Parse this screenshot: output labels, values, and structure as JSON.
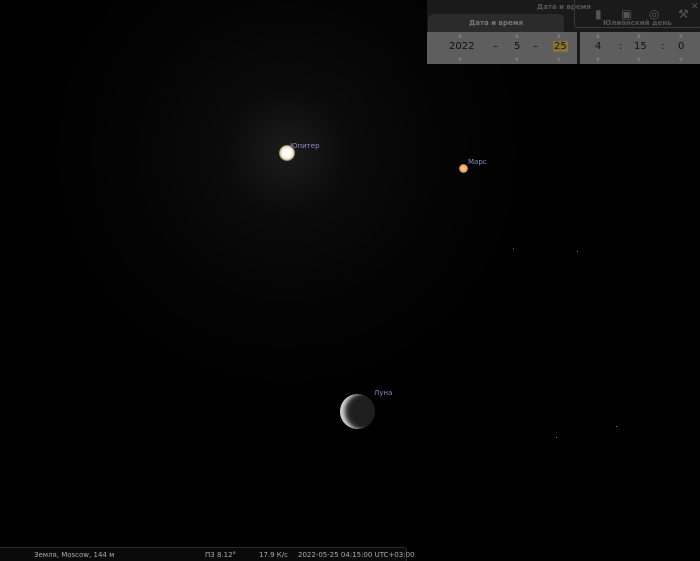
{
  "sky": {
    "jupiter_label": "Юпитер",
    "mars_label": "Марс",
    "moon_label": "Луна"
  },
  "datetime_panel": {
    "title": "Дата и время",
    "tab_label": "Дата и время",
    "julian_day_label": "Юлианский день",
    "year": "2022",
    "month": "5",
    "day": "25",
    "hour": "4",
    "minute": "15",
    "second": "0",
    "date_sep": "–",
    "time_sep": ":",
    "close": "✕"
  },
  "status_bar": {
    "location": "Земля, Moscow, 144 м",
    "fov": "П3 8.12°",
    "fps": "17.9 К/с",
    "datetime": "2022-05-25 04:15:00 UTC+03:00"
  },
  "colors": {
    "label": "#8c8cc4",
    "highlight": "#b8962e"
  }
}
